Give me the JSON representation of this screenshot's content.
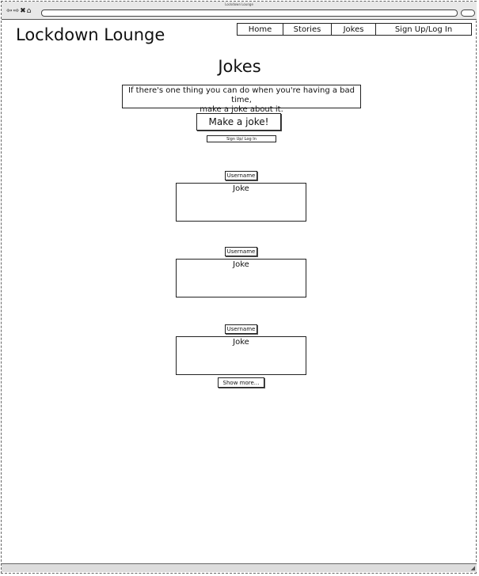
{
  "window": {
    "title": "Lockdown Lounge",
    "nav_icons": "⇦⇨✖⌂"
  },
  "header": {
    "site_title": "Lockdown Lounge"
  },
  "nav": {
    "items": [
      {
        "label": "Home"
      },
      {
        "label": "Stories"
      },
      {
        "label": "Jokes"
      },
      {
        "label": "Sign Up/Log In"
      }
    ]
  },
  "main": {
    "heading": "Jokes",
    "tagline_line1": "If there's one thing you can do when you're having a bad time,",
    "tagline_line2": "make a joke about it.",
    "make_button": "Make a joke!",
    "signup_link": "Sign Up/ Log In",
    "posts": [
      {
        "username": "Username",
        "joke": "Joke"
      },
      {
        "username": "Username",
        "joke": "Joke"
      },
      {
        "username": "Username",
        "joke": "Joke"
      }
    ],
    "show_more": "Show more..."
  }
}
